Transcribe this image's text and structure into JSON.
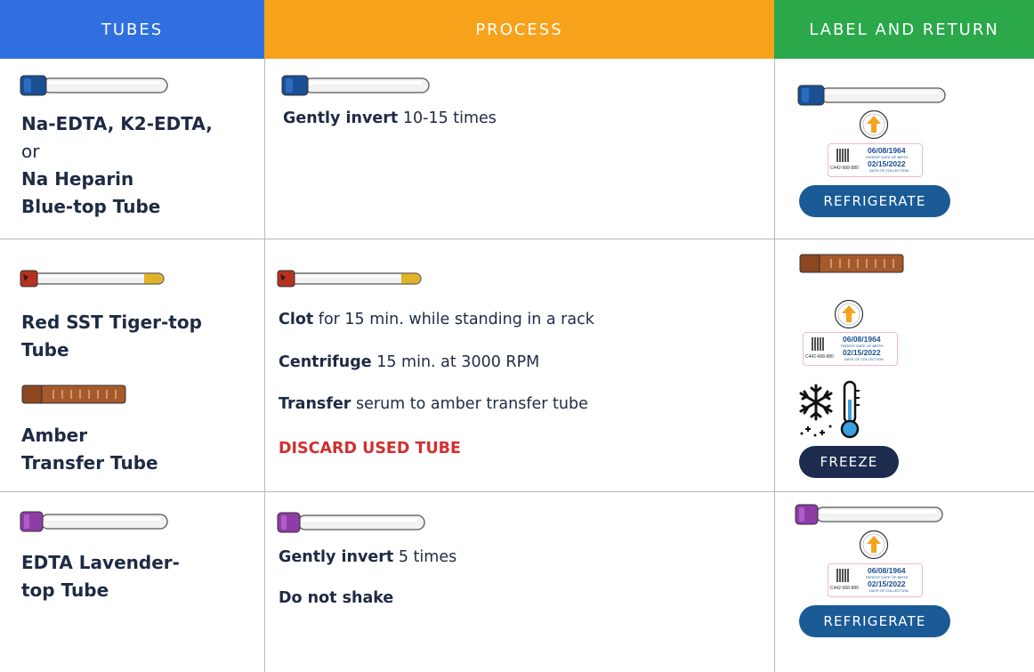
{
  "colors": {
    "tubes_header": "#2f6fdf",
    "process_header": "#f7a21b",
    "label_header": "#2aa84a",
    "blue_cap": "#1a4f93",
    "red_cap": "#b5321f",
    "gold_cap": "#e0b428",
    "amber_tube": "#a65a2b",
    "lavender_cap": "#8e3ca6",
    "arrow_orange": "#f7a21b",
    "warning_red": "#d32f2f",
    "refrigerate_badge": "#1a5b96",
    "freeze_badge": "#1d2b4e"
  },
  "headers": {
    "tubes": "TUBES",
    "process": "PROCESS",
    "label_return": "LABEL AND RETURN"
  },
  "rows": [
    {
      "tube_lines": [
        "Na-EDTA, K2-EDTA,",
        "or",
        "Na Heparin",
        "Blue-top Tube"
      ],
      "process": [
        {
          "bold": "Gently invert",
          "rest": " 10-15 times"
        }
      ],
      "action": "REFRIGERATE",
      "icons": [
        "blue-top-tube-icon",
        "upload-arrow-icon",
        "specimen-label-icon"
      ]
    },
    {
      "tube_a_lines": [
        "Red SST Tiger-top",
        "Tube"
      ],
      "tube_b_lines": [
        "Amber",
        "Transfer Tube"
      ],
      "process": [
        {
          "bold": "Clot",
          "rest": " for 15 min. while standing in a rack"
        },
        {
          "bold": "Centrifuge",
          "rest": " 15 min. at 3000 RPM"
        },
        {
          "bold": "Transfer",
          "rest": " serum to amber transfer tube"
        },
        {
          "bold": "DISCARD USED TUBE",
          "rest": ""
        }
      ],
      "action": "FREEZE",
      "icons": [
        "amber-transfer-tube-icon",
        "upload-arrow-icon",
        "specimen-label-icon",
        "snowflake-thermometer-icon"
      ]
    },
    {
      "tube_lines": [
        "EDTA Lavender-",
        "top Tube"
      ],
      "process": [
        {
          "bold": "Gently invert",
          "rest": " 5 times"
        },
        {
          "bold": "Do not shake",
          "rest": ""
        }
      ],
      "action": "REFRIGERATE",
      "icons": [
        "lavender-top-tube-icon",
        "upload-arrow-icon",
        "specimen-label-icon"
      ]
    }
  ],
  "specimen_label": {
    "dob": "06/08/1964",
    "dob_caption": "PATIENT DATE OF BIRTH",
    "doc": "02/15/2022",
    "doc_caption": "DATE OF COLLECTION",
    "id": "C442-668-880"
  }
}
